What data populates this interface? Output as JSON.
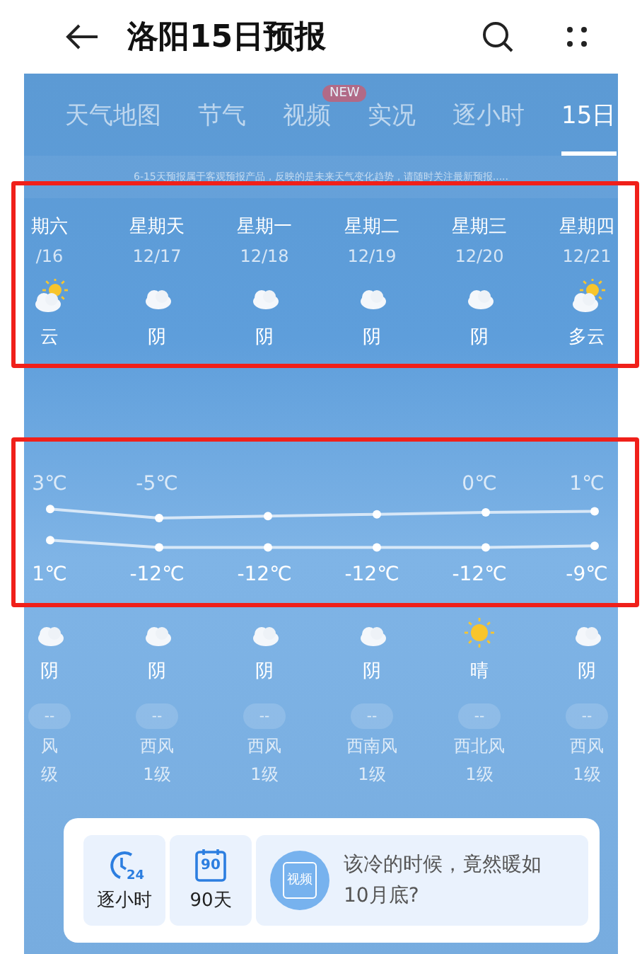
{
  "header": {
    "title": "洛阳15日预报"
  },
  "tabs": [
    {
      "label": "天气地图",
      "selected": false
    },
    {
      "label": "节气",
      "selected": false
    },
    {
      "label": "视频",
      "selected": false,
      "badge": "NEW"
    },
    {
      "label": "实况",
      "selected": false
    },
    {
      "label": "逐小时",
      "selected": false
    },
    {
      "label": "15日",
      "selected": true
    }
  ],
  "notice": "6-15天预报属于客观预报产品，反映的是未来天气变化趋势，请随时关注最新预报.....",
  "days": [
    {
      "weekday": "期六",
      "date": "/16",
      "day": {
        "kind": "partly-cloudy",
        "condition": "云"
      },
      "high": "3℃",
      "low": "1℃",
      "night": {
        "kind": "cloudy",
        "condition": "阴"
      },
      "air": "--",
      "wind": "风",
      "wind_level": "级"
    },
    {
      "weekday": "星期天",
      "date": "12/17",
      "day": {
        "kind": "cloudy",
        "condition": "阴"
      },
      "high": "-5℃",
      "low": "-12℃",
      "night": {
        "kind": "cloudy",
        "condition": "阴"
      },
      "air": "--",
      "wind": "西风",
      "wind_level": "1级"
    },
    {
      "weekday": "星期一",
      "date": "12/18",
      "day": {
        "kind": "cloudy",
        "condition": "阴"
      },
      "low": "-12℃",
      "night": {
        "kind": "cloudy",
        "condition": "阴"
      },
      "air": "--",
      "wind": "西风",
      "wind_level": "1级"
    },
    {
      "weekday": "星期二",
      "date": "12/19",
      "day": {
        "kind": "cloudy",
        "condition": "阴"
      },
      "low": "-12℃",
      "night": {
        "kind": "cloudy",
        "condition": "阴"
      },
      "air": "--",
      "wind": "西南风",
      "wind_level": "1级"
    },
    {
      "weekday": "星期三",
      "date": "12/20",
      "day": {
        "kind": "cloudy",
        "condition": "阴"
      },
      "high": "0℃",
      "low": "-12℃",
      "night": {
        "kind": "sunny",
        "condition": "晴"
      },
      "air": "--",
      "wind": "西北风",
      "wind_level": "1级"
    },
    {
      "weekday": "星期四",
      "date": "12/21",
      "day": {
        "kind": "partly-cloudy",
        "condition": "多云"
      },
      "high": "1℃",
      "low": "-9℃",
      "night": {
        "kind": "cloudy",
        "condition": "阴"
      },
      "air": "--",
      "wind": "西风",
      "wind_level": "1级"
    }
  ],
  "shortcuts": [
    {
      "kind": "clock",
      "icon_text": "24",
      "label": "逐小时"
    },
    {
      "kind": "calendar",
      "icon_text": "90",
      "label": "90天"
    }
  ],
  "promo": {
    "badge": "视频",
    "text": "该冷的时候，竟然暖如10月底?"
  }
}
